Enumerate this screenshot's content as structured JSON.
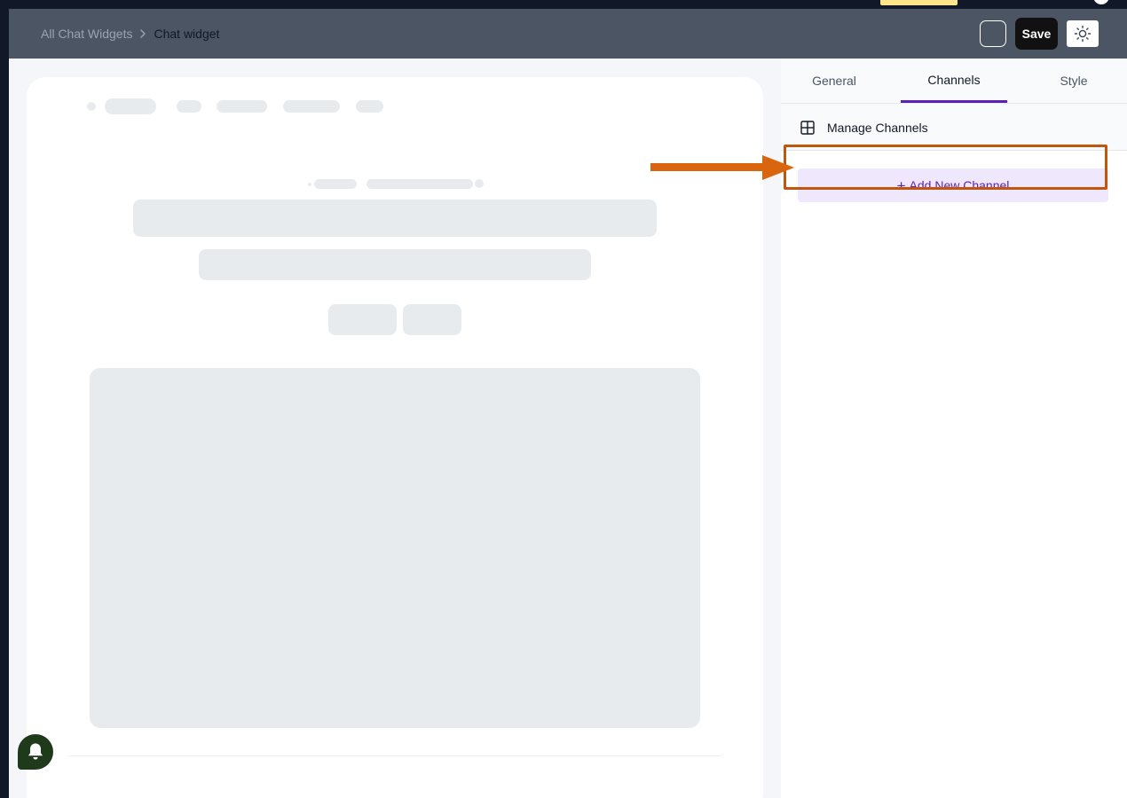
{
  "header": {
    "breadcrumb": {
      "parent": "All Chat Widgets",
      "current": "Chat widget"
    },
    "save_label": "Save"
  },
  "sidebar": {
    "tabs": [
      {
        "label": "General",
        "active": false
      },
      {
        "label": "Channels",
        "active": true
      },
      {
        "label": "Style",
        "active": false
      }
    ],
    "section_title": "Manage Channels",
    "add_channel_label": "Add New Channel",
    "add_channel_icon": "+"
  },
  "colors": {
    "header_bg": "#4b5563",
    "accent_purple": "#5b21b6",
    "add_button_bg": "#efe7fb",
    "highlight_orange": "#c2560c",
    "notification_bg": "#1f3a1a"
  },
  "icons": {
    "crumb_separator": "chevron-right-icon",
    "theme": "sun-icon",
    "section": "grid-icon",
    "notification": "bell-icon",
    "annotation": "arrow-right-icon"
  }
}
